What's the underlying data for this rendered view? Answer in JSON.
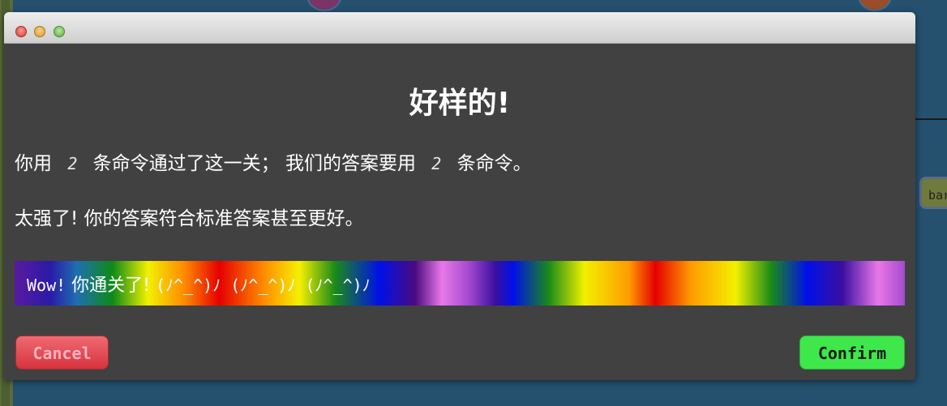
{
  "dialog": {
    "title": "好样的!",
    "line1": {
      "part1": "你用",
      "your_count": "2",
      "part2": "条命令通过了这一关；  我们的答案要用",
      "solution_count": "2",
      "part3": "条命令。"
    },
    "line2": "太强了! 你的答案符合标准答案甚至更好。",
    "banner": {
      "wow": "Wow!",
      "passed": "你通关了!",
      "emoticons": "(ﾉ^_^)ﾉ (ﾉ^_^)ﾉ (ﾉ^_^)ﾉ"
    },
    "buttons": {
      "cancel": "Cancel",
      "confirm": "Confirm"
    }
  },
  "background": {
    "branch_label": "bar"
  },
  "colors": {
    "dialog_bg": "#414141",
    "cancel": "#e0424c",
    "confirm": "#3ee84a",
    "scene_bg": "#25506e"
  }
}
